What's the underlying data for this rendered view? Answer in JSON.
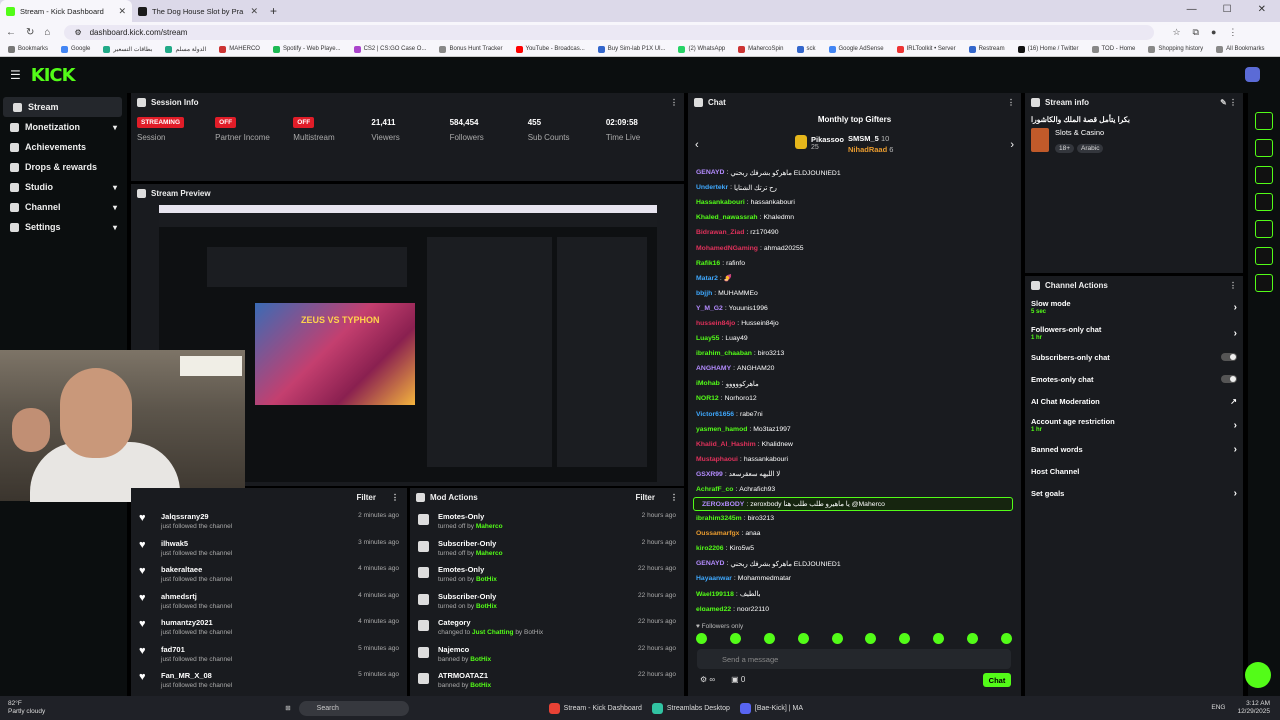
{
  "browser": {
    "tabs": [
      {
        "title": "Stream - Kick Dashboard",
        "color": "#53fc18"
      },
      {
        "title": "The Dog House Slot by Pra",
        "color": "#1a1a1a"
      }
    ],
    "url": "dashboard.kick.com/stream"
  },
  "bookmarks": [
    "Bookmarks",
    "Google",
    "بطاقات التسعير",
    "الدولة مسلم",
    "MAHERCO",
    "Spotify - Web Playe...",
    "CS2 | CS:GO Case O...",
    "Bonus Hunt Tracker",
    "YouTube - Broadcas...",
    "Buy Sim-lab P1X Ul...",
    "(2) WhatsApp",
    "MahercoSpin",
    "sck",
    "Google AdSense",
    "IRLToolkit • Server",
    "Restream",
    "(16) Home / Twitter",
    "TOD - Home",
    "Shopping history",
    "All Bookmarks"
  ],
  "sidebar": {
    "items": [
      {
        "label": "Stream",
        "active": true
      },
      {
        "label": "Monetization",
        "chev": "▾"
      },
      {
        "label": "Achievements"
      },
      {
        "label": "Drops & rewards"
      },
      {
        "label": "Studio",
        "chev": "▾"
      },
      {
        "label": "Channel",
        "chev": "▾"
      },
      {
        "label": "Settings",
        "chev": "▾"
      }
    ]
  },
  "session": {
    "title": "Session Info",
    "stats": [
      {
        "value": "STREAMING",
        "label": "Session",
        "badge": true
      },
      {
        "value": "OFF",
        "label": "Partner Income",
        "badge": true
      },
      {
        "value": "OFF",
        "label": "Multistream",
        "badge": true
      },
      {
        "value": "21,411",
        "label": "Viewers"
      },
      {
        "value": "584,454",
        "label": "Followers"
      },
      {
        "value": "455",
        "label": "Sub Counts"
      },
      {
        "value": "02:09:58",
        "label": "Time Live"
      }
    ]
  },
  "preview": {
    "title": "Stream Preview",
    "game_text": "ZEUS VS TYPHON"
  },
  "feed": {
    "filter": "Filter",
    "items": [
      {
        "name": "Jalqssrany29",
        "sub": "just followed the channel",
        "time": "2 minutes ago"
      },
      {
        "name": "ilhwak5",
        "sub": "just followed the channel",
        "time": "3 minutes ago"
      },
      {
        "name": "bakeraltaee",
        "sub": "just followed the channel",
        "time": "4 minutes ago"
      },
      {
        "name": "ahmedsrtj",
        "sub": "just followed the channel",
        "time": "4 minutes ago"
      },
      {
        "name": "humantzy2021",
        "sub": "just followed the channel",
        "time": "4 minutes ago"
      },
      {
        "name": "fad701",
        "sub": "just followed the channel",
        "time": "5 minutes ago"
      },
      {
        "name": "Fan_MR_X_08",
        "sub": "just followed the channel",
        "time": "5 minutes ago"
      }
    ]
  },
  "mod": {
    "title": "Mod Actions",
    "filter": "Filter",
    "items": [
      {
        "name": "Emotes-Only",
        "pre": "turned off by",
        "by": "Maherco",
        "time": "2 hours ago"
      },
      {
        "name": "Subscriber-Only",
        "pre": "turned off by",
        "by": "Maherco",
        "time": "2 hours ago"
      },
      {
        "name": "Emotes-Only",
        "pre": "turned on by",
        "by": "BotHix",
        "time": "22 hours ago"
      },
      {
        "name": "Subscriber-Only",
        "pre": "turned on by",
        "by": "BotHix",
        "time": "22 hours ago"
      },
      {
        "name": "Category",
        "pre": "changed to",
        "by": "Just Chatting",
        "post": " by BotHix",
        "time": "22 hours ago"
      },
      {
        "name": "Najemco",
        "pre": "banned by",
        "by": "BotHix",
        "time": "22 hours ago"
      },
      {
        "name": "ATRMOATAZ1",
        "pre": "banned by",
        "by": "BotHix",
        "time": "22 hours ago"
      }
    ]
  },
  "chat": {
    "title": "Chat",
    "gifters_title": "Monthly top Gifters",
    "g1_name": "Pikassoo",
    "g1_count": "25",
    "g2_name": "SMSM_5",
    "g2_count": "10",
    "g3_name": "NihadRaad",
    "g3_count": "6",
    "messages": [
      {
        "u": "GENAYD",
        "c": "#b48cff",
        "t": "ماهركو بشرفك ربحني ELDJOUNIED1"
      },
      {
        "u": "Undertekr",
        "c": "#3fa9ff",
        "t": "رح ترتك الشتايا"
      },
      {
        "u": "Hassankabouri",
        "c": "#53fc18",
        "t": "hassankabouri"
      },
      {
        "u": "Khaled_nawassrah",
        "c": "#53fc18",
        "t": "Khaledmn"
      },
      {
        "u": "Bidrawan_Ziad",
        "c": "#e0315b",
        "t": "rz170490"
      },
      {
        "u": "MohamedNGaming",
        "c": "#e0315b",
        "t": "ahmad20255"
      },
      {
        "u": "Rafik16",
        "c": "#53fc18",
        "t": "rafinfo"
      },
      {
        "u": "Matar2",
        "c": "#3fa9ff",
        "t": "🍠"
      },
      {
        "u": "bbjjh",
        "c": "#3fa9ff",
        "t": "MUHAMMEo"
      },
      {
        "u": "Y_M_G2",
        "c": "#b48cff",
        "t": "Youunis1996"
      },
      {
        "u": "hussein84jo",
        "c": "#e0315b",
        "t": "Hussein84jo"
      },
      {
        "u": "Luay55",
        "c": "#53fc18",
        "t": "Luay49"
      },
      {
        "u": "ibrahim_chaaban",
        "c": "#53fc18",
        "t": "biro3213"
      },
      {
        "u": "ANGHAMY",
        "c": "#b48cff",
        "t": "ANGHAM20"
      },
      {
        "u": "iMohab",
        "c": "#53fc18",
        "t": "ماهركووووو"
      },
      {
        "u": "NOR12",
        "c": "#53fc18",
        "t": "Norhoro12"
      },
      {
        "u": "Victor61656",
        "c": "#3fa9ff",
        "t": "rabe7ni"
      },
      {
        "u": "yasmen_hamod",
        "c": "#53fc18",
        "t": "Mo3taz1997"
      },
      {
        "u": "Khalid_Al_Hashim",
        "c": "#e0315b",
        "t": "Khalidnew"
      },
      {
        "u": "Mustaphaoui",
        "c": "#e0315b",
        "t": "hassankabouri"
      },
      {
        "u": "GSXR99",
        "c": "#b48cff",
        "t": "لا الليهه سعقرسعد"
      },
      {
        "u": "AchrafF_co",
        "c": "#53fc18",
        "t": "Achrafich93"
      },
      {
        "u": "ZEROxBODY",
        "c": "#b48cff",
        "t": "zeroxbody يا ماهيرو طلب طلب هنا @Maherco",
        "hl": true
      },
      {
        "u": "ibrahim3245m",
        "c": "#53fc18",
        "t": "biro3213"
      },
      {
        "u": "Oussamarfgx",
        "c": "#e89b2f",
        "t": "anaa"
      },
      {
        "u": "kiro2206",
        "c": "#53fc18",
        "t": "Kiro5w5"
      },
      {
        "u": "GENAYD",
        "c": "#b48cff",
        "t": "ماهركو بشرفك ربحني ELDJOUNIED1"
      },
      {
        "u": "Hayaanwar",
        "c": "#3fa9ff",
        "t": "Mohammedmatar"
      },
      {
        "u": "Wael199118",
        "c": "#53fc18",
        "t": "بالطيف"
      },
      {
        "u": "elgamed22",
        "c": "#53fc18",
        "t": "noor22110"
      }
    ],
    "followers_only": "Followers only",
    "placeholder": "Send a message",
    "send": "Chat",
    "count": "0"
  },
  "stream_info": {
    "title": "Stream info",
    "stream_title": "بكرا يتأمل قصة الملك والكاشورا",
    "category": "Slots & Casino",
    "tags": [
      "18+",
      "Arabic"
    ]
  },
  "channel_actions": {
    "title": "Channel Actions",
    "rows": [
      {
        "label": "Slow mode",
        "sub": "5 sec",
        "kind": "arrow"
      },
      {
        "label": "Followers-only chat",
        "sub": "1 hr",
        "kind": "arrow"
      },
      {
        "label": "Subscribers-only chat",
        "kind": "toggle"
      },
      {
        "label": "Emotes-only chat",
        "kind": "toggle"
      },
      {
        "label": "AI Chat Moderation",
        "kind": "ext"
      },
      {
        "label": "Account age restriction",
        "sub": "1 hr",
        "kind": "arrow"
      },
      {
        "label": "Banned words",
        "kind": "arrow"
      },
      {
        "label": "Host Channel",
        "kind": "none"
      },
      {
        "label": "Set goals",
        "kind": "arrow"
      }
    ]
  },
  "taskbar": {
    "temp": "82°F",
    "weather": "Partly cloudy",
    "search": "Search",
    "apps": [
      "Stream - Kick Dashboard",
      "Streamlabs Desktop",
      "[Bae-Kick] | MA"
    ],
    "lang": "ENG",
    "time": "3:12 AM",
    "date": "12/29/2025"
  },
  "colors": {
    "brand": "#53fc18",
    "danger": "#e11d28"
  }
}
